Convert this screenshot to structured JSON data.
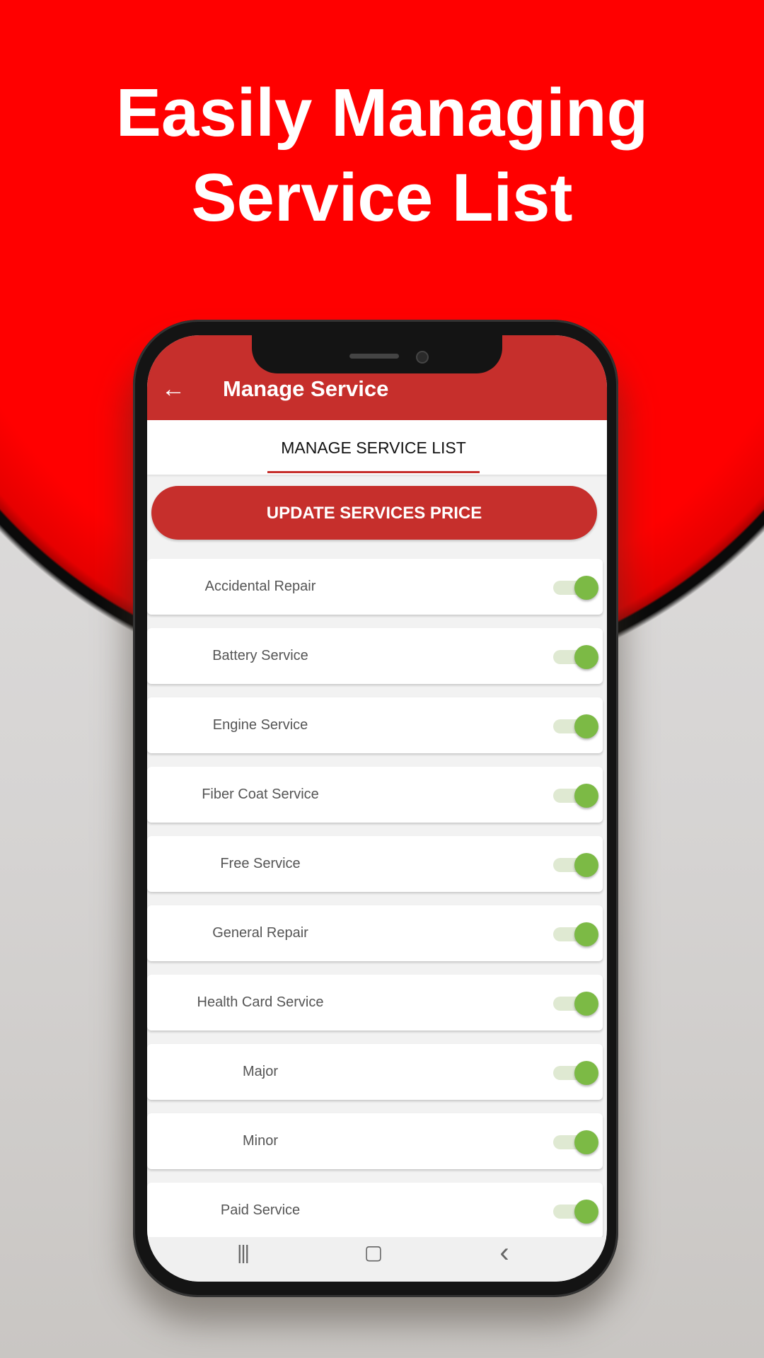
{
  "headline": {
    "line1": "Easily Managing",
    "line2": "Service List"
  },
  "colors": {
    "brand_red": "#c62f2c",
    "background_red": "#ff0000",
    "toggle_on": "#7cba45"
  },
  "appbar": {
    "back_icon": "arrow-left-icon",
    "back_glyph": "←",
    "title": "Manage Service"
  },
  "tabs": [
    {
      "label": "MANAGE SERVICE LIST",
      "selected": true
    }
  ],
  "update_button": {
    "label": "UPDATE SERVICES PRICE"
  },
  "services": [
    {
      "name": "Accidental Repair",
      "enabled": true
    },
    {
      "name": "Battery Service",
      "enabled": true
    },
    {
      "name": "Engine Service",
      "enabled": true
    },
    {
      "name": "Fiber Coat Service",
      "enabled": true
    },
    {
      "name": "Free Service",
      "enabled": true
    },
    {
      "name": "General Repair",
      "enabled": true
    },
    {
      "name": "Health Card Service",
      "enabled": true
    },
    {
      "name": "Major",
      "enabled": true
    },
    {
      "name": "Minor",
      "enabled": true
    },
    {
      "name": "Paid Service",
      "enabled": true
    }
  ],
  "navbar": {
    "recents_glyph": "|||",
    "home_glyph": "▢",
    "back_glyph": "‹"
  }
}
